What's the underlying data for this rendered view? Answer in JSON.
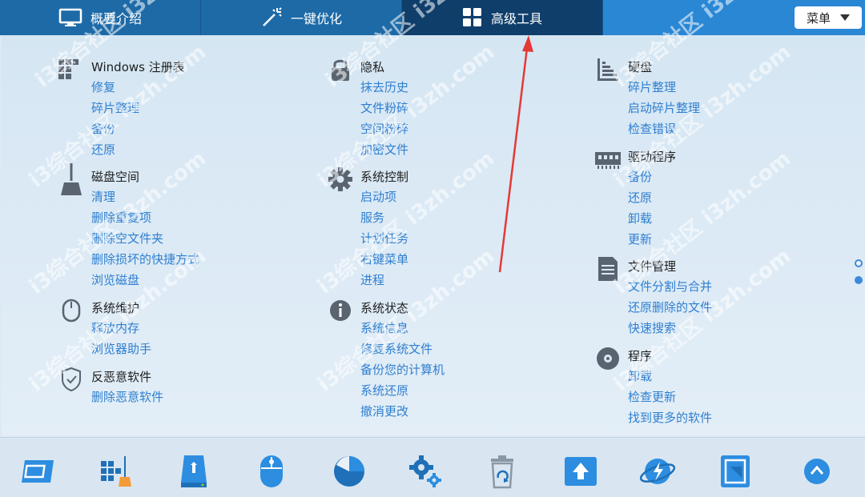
{
  "tabs": [
    {
      "label": "概要介绍",
      "icon": "monitor-icon"
    },
    {
      "label": "一键优化",
      "icon": "magic-wand-icon"
    },
    {
      "label": "高级工具",
      "icon": "grid-icon",
      "active": true
    }
  ],
  "menu": {
    "label": "菜单"
  },
  "columns": [
    {
      "groups": [
        {
          "title": "Windows 注册表",
          "icon": "registry-icon",
          "links": [
            "修复",
            "碎片整理",
            "备份",
            "还原"
          ]
        },
        {
          "title": "磁盘空间",
          "icon": "broom-icon",
          "links": [
            "清理",
            "删除重复项",
            "删除空文件夹",
            "删除损坏的快捷方式",
            "浏览磁盘"
          ]
        },
        {
          "title": "系统维护",
          "icon": "mouse-icon",
          "links": [
            "释放内存",
            "浏览器助手"
          ]
        },
        {
          "title": "反恶意软件",
          "icon": "shield-icon",
          "links": [
            "删除恶意软件"
          ]
        }
      ]
    },
    {
      "groups": [
        {
          "title": "隐私",
          "icon": "lock-icon",
          "links": [
            "抹去历史",
            "文件粉碎",
            "空间粉碎",
            "加密文件"
          ]
        },
        {
          "title": "系统控制",
          "icon": "gear-icon",
          "links": [
            "启动项",
            "服务",
            "计划任务",
            "右键菜单",
            "进程"
          ]
        },
        {
          "title": "系统状态",
          "icon": "info-icon",
          "links": [
            "系统信息",
            "修复系统文件",
            "备份您的计算机",
            "系统还原",
            "撤消更改"
          ]
        }
      ]
    },
    {
      "groups": [
        {
          "title": "硬盘",
          "icon": "disk-chart-icon",
          "links": [
            "碎片整理",
            "启动碎片整理",
            "检查错误"
          ]
        },
        {
          "title": "驱动程序",
          "icon": "memory-chip-icon",
          "links": [
            "备份",
            "还原",
            "卸载",
            "更新"
          ]
        },
        {
          "title": "文件管理",
          "icon": "document-icon",
          "links": [
            "文件分割与合并",
            "还原删除的文件",
            "快速搜索"
          ]
        },
        {
          "title": "程序",
          "icon": "disc-icon",
          "links": [
            "卸载",
            "检查更新",
            "找到更多的软件"
          ]
        }
      ]
    }
  ],
  "bottom_tools": [
    "screen-icon",
    "registry-clean-icon",
    "disk-icon",
    "mouse-icon",
    "pie-chart-icon",
    "gears-icon",
    "recycle-bin-icon",
    "upload-icon",
    "browser-icon",
    "file-icon",
    "scroll-up-icon"
  ],
  "watermark": "i3综合社区 i3zh.com",
  "colors": {
    "tab_bar": "#1d6aa7",
    "tab_active": "#0f3e6b",
    "link": "#2f7fd0",
    "accent": "#3d8ad9",
    "arrow": "#e53935"
  }
}
